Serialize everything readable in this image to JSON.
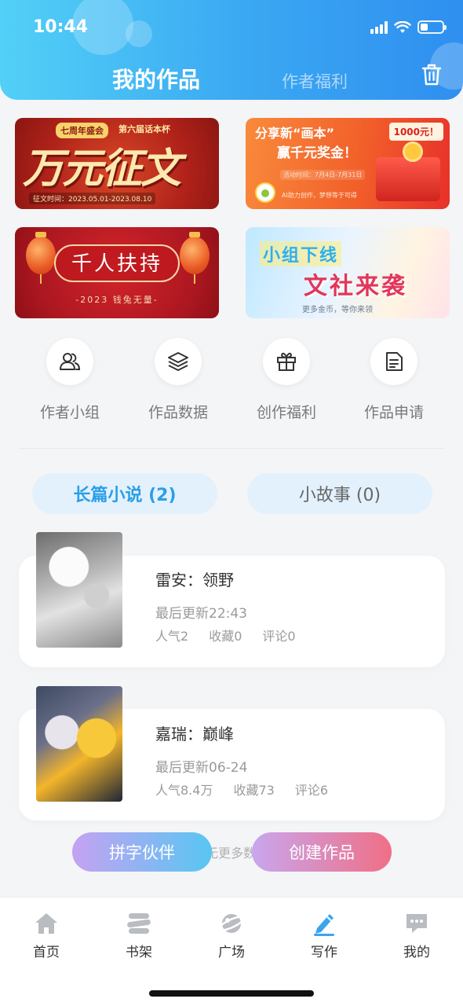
{
  "status_bar": {
    "time": "10:44",
    "battery_level": 0.35
  },
  "header": {
    "tabs": [
      {
        "label": "我的作品",
        "active": true
      },
      {
        "label": "作者福利",
        "active": false
      }
    ],
    "trash_icon": "trash-icon"
  },
  "banners": [
    {
      "tag": "七周年盛会",
      "tag2": "第六届话本杯",
      "title": "万元征文",
      "date": "征文时间：2023.05.01-2023.08.10"
    },
    {
      "title": "分享新“画本”",
      "subtitle": "赢千元奖金！",
      "prize": "1000元！",
      "date": "活动时间：7月4日-7月31日",
      "footer": "AI助力创作，梦想等于可得"
    },
    {
      "title": "千人扶持",
      "subtitle": "-2023 钱兔无量-"
    },
    {
      "title_top": "小组下线",
      "title_main": "文社来袭",
      "footer": "更多金币，等你来领"
    }
  ],
  "quick_actions": [
    {
      "label": "作者小组",
      "icon": "users-icon"
    },
    {
      "label": "作品数据",
      "icon": "layers-icon"
    },
    {
      "label": "创作福利",
      "icon": "gift-icon"
    },
    {
      "label": "作品申请",
      "icon": "document-icon"
    }
  ],
  "categories": [
    {
      "label": "长篇小说 (2)",
      "active": true
    },
    {
      "label": "小故事 (0)",
      "active": false
    }
  ],
  "works": [
    {
      "title": "雷安：领野",
      "updated": "最后更新22:43",
      "popularity": "人气2",
      "favorites": "收藏0",
      "comments": "评论0"
    },
    {
      "title": "嘉瑞：巅峰",
      "updated": "最后更新06-24",
      "popularity": "人气8.4万",
      "favorites": "收藏73",
      "comments": "评论6"
    }
  ],
  "list_footer": "无更多数据",
  "fabs": {
    "partner": "拼字伙伴",
    "create": "创建作品"
  },
  "bottom_nav": [
    {
      "label": "首页",
      "icon": "home-icon",
      "active": false
    },
    {
      "label": "书架",
      "icon": "bookshelf-icon",
      "active": false
    },
    {
      "label": "广场",
      "icon": "planet-icon",
      "active": false
    },
    {
      "label": "写作",
      "icon": "pen-icon",
      "active": true
    },
    {
      "label": "我的",
      "icon": "chat-icon",
      "active": false
    }
  ],
  "colors": {
    "header_start": "#52d0f7",
    "header_end": "#2f8ff0",
    "accent": "#2a9ee8",
    "pill_bg": "#e3f1fc",
    "create_gradient_end": "#ef6f86"
  }
}
